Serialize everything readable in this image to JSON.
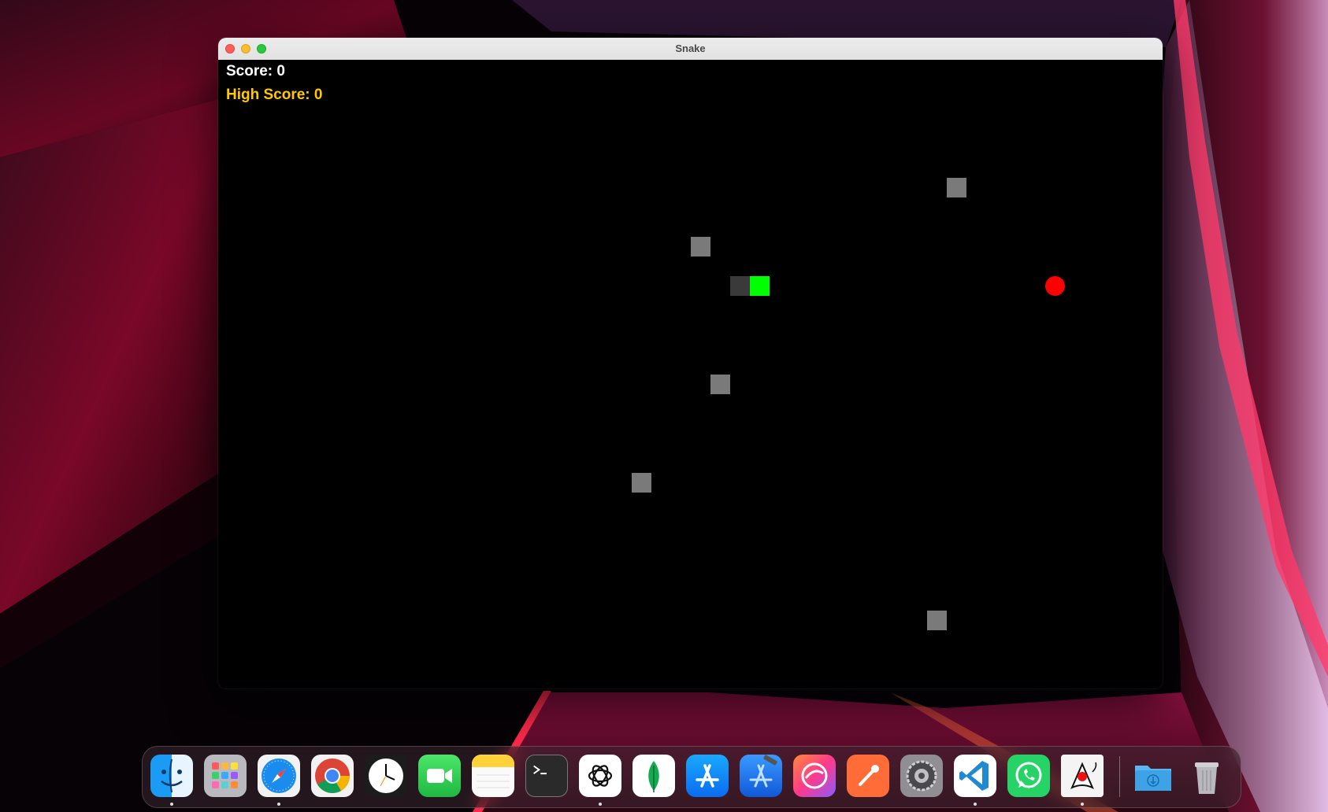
{
  "window": {
    "title": "Snake"
  },
  "hud": {
    "score_label": "Score: 0",
    "high_score_label": "High Score: 0"
  },
  "game": {
    "colors": {
      "background": "#000000",
      "snake_head": "#00ff00",
      "snake_body": "#3a3a3a",
      "obstacle": "#7a7a7a",
      "food": "#ff0000",
      "score_text": "#ffffff",
      "high_score_text": "#ffc800"
    }
  },
  "dock": {
    "items": [
      {
        "name": "finder-icon",
        "running": true
      },
      {
        "name": "launchpad-icon",
        "running": false
      },
      {
        "name": "safari-icon",
        "running": true
      },
      {
        "name": "chrome-icon",
        "running": false
      },
      {
        "name": "clock-icon",
        "running": false
      },
      {
        "name": "facetime-icon",
        "running": false
      },
      {
        "name": "notes-icon",
        "running": false
      },
      {
        "name": "terminal-icon",
        "running": false
      },
      {
        "name": "chatgpt-icon",
        "running": true
      },
      {
        "name": "mongodb-compass-icon",
        "running": false
      },
      {
        "name": "app-store-icon",
        "running": false
      },
      {
        "name": "xcode-icon",
        "running": false
      },
      {
        "name": "affinity-icon",
        "running": false
      },
      {
        "name": "postman-icon",
        "running": false
      },
      {
        "name": "system-settings-icon",
        "running": false
      },
      {
        "name": "vscode-icon",
        "running": true
      },
      {
        "name": "whatsapp-icon",
        "running": false
      },
      {
        "name": "java-app-icon",
        "running": true
      },
      {
        "name": "downloads-folder-icon",
        "running": false
      },
      {
        "name": "trash-icon",
        "running": false
      }
    ]
  }
}
